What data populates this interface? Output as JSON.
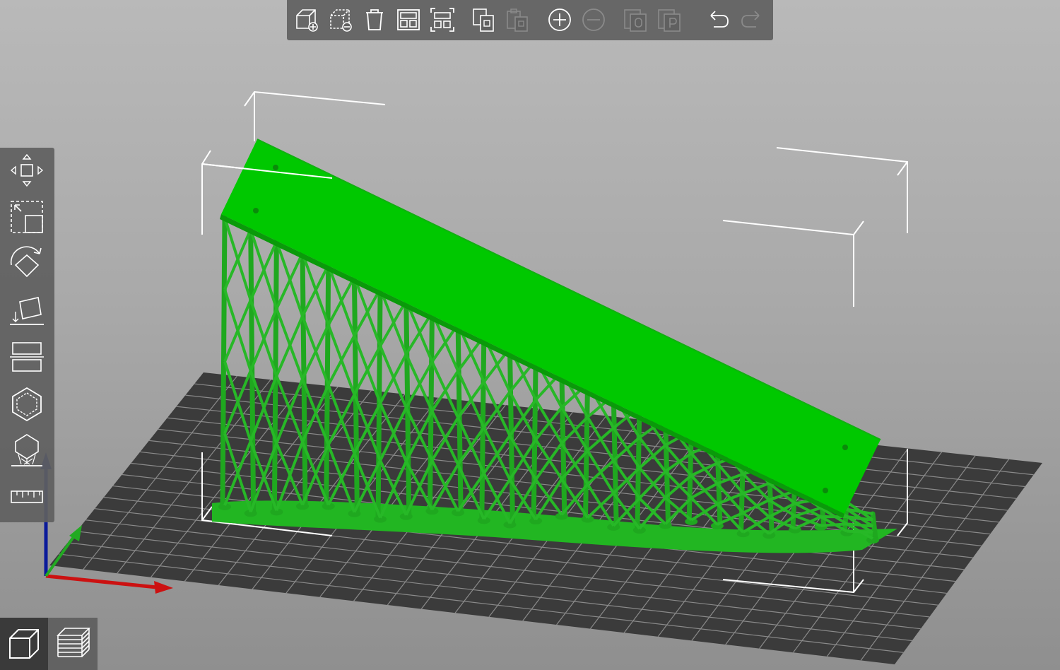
{
  "app": {
    "view": "3D",
    "accent_color": "#00c800",
    "bed_color": "#3c3c3c"
  },
  "top_toolbar": {
    "items": [
      {
        "name": "add-icon",
        "enabled": true
      },
      {
        "name": "delete-icon",
        "enabled": true
      },
      {
        "name": "delete-all-icon",
        "enabled": true
      },
      {
        "name": "arrange-icon",
        "enabled": true
      },
      {
        "name": "arrange-selection-icon",
        "enabled": true
      },
      {
        "name": "copy-icon",
        "enabled": true
      },
      {
        "name": "paste-icon",
        "enabled": false
      },
      {
        "name": "add-instance-icon",
        "enabled": true
      },
      {
        "name": "remove-instance-icon",
        "enabled": false
      },
      {
        "name": "split-objects-icon",
        "enabled": false
      },
      {
        "name": "split-parts-icon",
        "enabled": false
      },
      {
        "name": "undo-icon",
        "enabled": true
      },
      {
        "name": "redo-icon",
        "enabled": false
      }
    ]
  },
  "left_toolbar": {
    "items": [
      {
        "name": "move-icon"
      },
      {
        "name": "scale-icon"
      },
      {
        "name": "rotate-icon"
      },
      {
        "name": "place-on-face-icon"
      },
      {
        "name": "cut-icon"
      },
      {
        "name": "hollow-icon"
      },
      {
        "name": "support-points-icon"
      },
      {
        "name": "measure-icon"
      }
    ]
  },
  "view_switch": {
    "items": [
      {
        "name": "3d-view-icon",
        "active": true
      },
      {
        "name": "preview-layers-icon",
        "active": false
      }
    ]
  },
  "axes_colors": {
    "x": "#cc1111",
    "y": "#22aa22",
    "z": "#0a1a9a"
  }
}
